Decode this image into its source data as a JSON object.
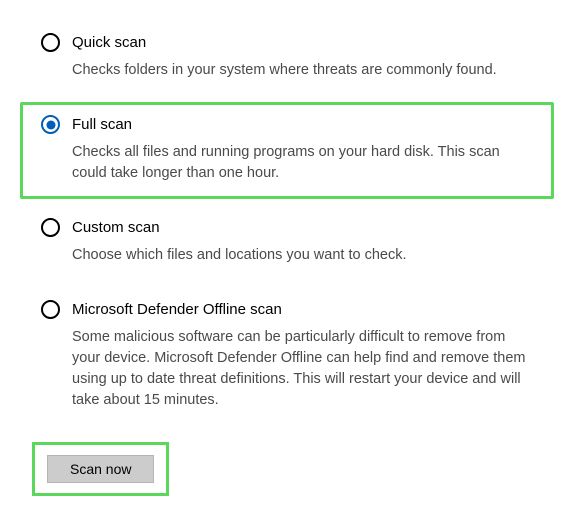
{
  "options": [
    {
      "key": "quick",
      "title": "Quick scan",
      "desc": "Checks folders in your system where threats are commonly found.",
      "selected": false,
      "highlight": false
    },
    {
      "key": "full",
      "title": "Full scan",
      "desc": "Checks all files and running programs on your hard disk. This scan could take longer than one hour.",
      "selected": true,
      "highlight": true
    },
    {
      "key": "custom",
      "title": "Custom scan",
      "desc": "Choose which files and locations you want to check.",
      "selected": false,
      "highlight": false
    },
    {
      "key": "offline",
      "title": "Microsoft Defender Offline scan",
      "desc": "Some malicious software can be particularly difficult to remove from your device. Microsoft Defender Offline can help find and remove them using up to date threat definitions. This will restart your device and will take about 15 minutes.",
      "selected": false,
      "highlight": false
    }
  ],
  "actions": {
    "scan_now": "Scan now"
  }
}
